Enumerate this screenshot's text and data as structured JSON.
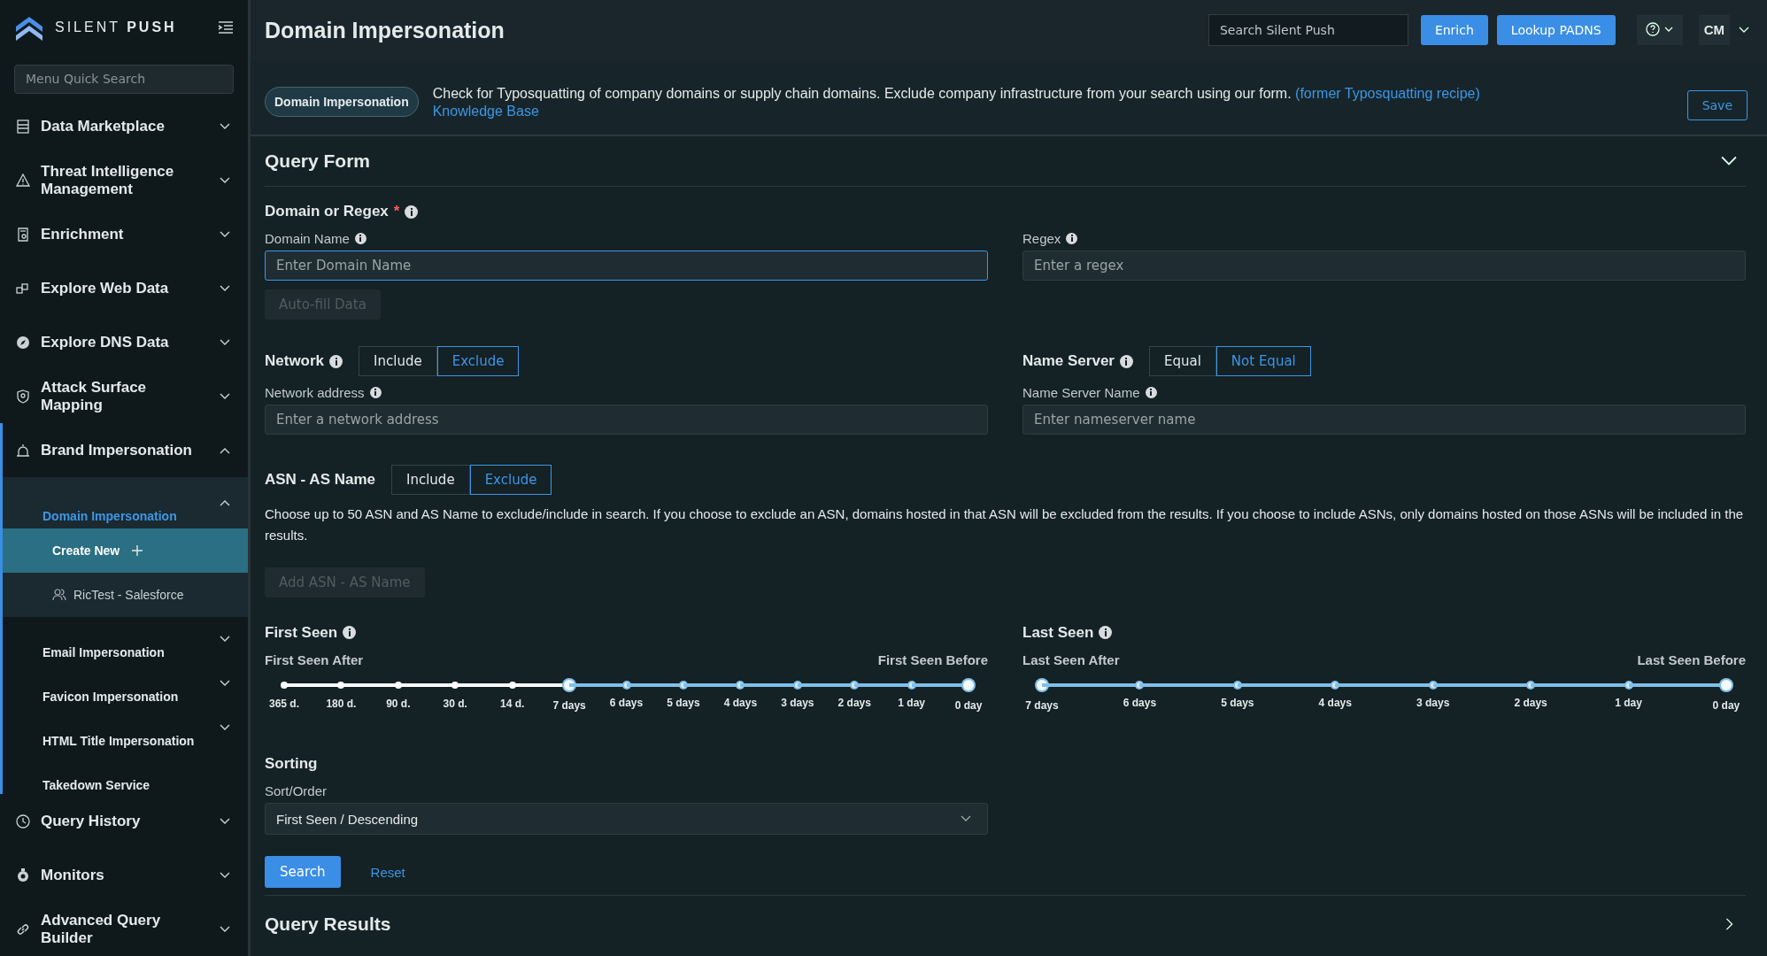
{
  "sidebar": {
    "brand": {
      "word_1": "SILENT",
      "word_2": "PUSH"
    },
    "search": {
      "placeholder": "Menu Quick Search"
    },
    "items": [
      {
        "label": "Data Marketplace",
        "expanded": false,
        "selected": false
      },
      {
        "label": "Threat Intelligence Management",
        "expanded": false,
        "selected": false
      },
      {
        "label": "Enrichment",
        "expanded": false,
        "selected": false
      },
      {
        "label": "Explore Web Data",
        "expanded": false,
        "selected": false
      },
      {
        "label": "Explore DNS Data",
        "expanded": false,
        "selected": false
      },
      {
        "label": "Attack Surface Mapping",
        "expanded": false,
        "selected": false
      },
      {
        "label": "Brand Impersonation",
        "expanded": true,
        "selected": true,
        "children": [
          {
            "label": "Domain Impersonation",
            "expanded": true,
            "selected": true,
            "children": [
              {
                "kind": "create",
                "label": "Create New",
                "selected": true
              },
              {
                "kind": "saved",
                "label": "RicTest - Salesforce",
                "selected": false
              }
            ]
          },
          {
            "label": "Email Impersonation",
            "expanded": false,
            "selected": false
          },
          {
            "label": "Favicon Impersonation",
            "expanded": false,
            "selected": false
          },
          {
            "label": "HTML Title Impersonation",
            "expanded": false,
            "selected": false
          },
          {
            "label": "Takedown Service",
            "selected": false
          }
        ]
      },
      {
        "label": "Query History",
        "expanded": false,
        "selected": false
      },
      {
        "label": "Monitors",
        "expanded": false,
        "selected": false
      },
      {
        "label": "Advanced Query Builder",
        "expanded": false,
        "selected": false
      }
    ]
  },
  "header": {
    "title": "Domain Impersonation",
    "search": {
      "placeholder": "Search Silent Push"
    },
    "buttons": [
      "Enrich",
      "Lookup PADNS"
    ],
    "user": "CM"
  },
  "info_bar": {
    "tag": "Domain Impersonation",
    "description": "Check for Typosquatting of company domains or supply chain domains. Exclude company infrastructure from your search using our form.",
    "link_1": "(former Typosquatting recipe)",
    "link_2": "Knowledge Base",
    "save": "Save"
  },
  "query_form": {
    "title": "Query Form",
    "expanded": true,
    "domain_group": {
      "label": "Domain or Regex",
      "required_mark": "*"
    },
    "domain_name": {
      "label": "Domain Name",
      "placeholder": "Enter Domain Name",
      "focused": true
    },
    "regex": {
      "label": "Regex",
      "placeholder": "Enter a regex"
    },
    "autofill": {
      "label": "Auto-fill Data",
      "disabled": true
    },
    "network": {
      "label": "Network",
      "options": [
        {
          "label": "Include",
          "selected": false
        },
        {
          "label": "Exclude",
          "selected": true
        }
      ],
      "field_label": "Network address",
      "placeholder": "Enter a network address"
    },
    "name_server": {
      "label": "Name Server",
      "options": [
        {
          "label": "Equal",
          "selected": false
        },
        {
          "label": "Not Equal",
          "selected": true
        }
      ],
      "field_label": "Name Server Name",
      "placeholder": "Enter nameserver name"
    },
    "asn": {
      "label": "ASN - AS Name",
      "options": [
        {
          "label": "Include",
          "selected": false
        },
        {
          "label": "Exclude",
          "selected": true
        }
      ],
      "description": "Choose up to 50 ASN and AS Name to exclude/include in search. If you choose to exclude an ASN, domains hosted in that ASN will be excluded from the results. If you choose to include ASNs, only domains hosted on those ASNs will be included in the results.",
      "add": {
        "label": "Add ASN - AS Name",
        "disabled": true
      }
    },
    "first_seen": {
      "label": "First Seen",
      "after": "First Seen After",
      "before": "First Seen Before",
      "ticks": [
        {
          "label": "365 d.",
          "in_range": false,
          "selected": false
        },
        {
          "label": "180 d.",
          "in_range": false,
          "selected": false
        },
        {
          "label": "90 d.",
          "in_range": false,
          "selected": false
        },
        {
          "label": "30 d.",
          "in_range": false,
          "selected": false
        },
        {
          "label": "14 d.",
          "in_range": false,
          "selected": false
        },
        {
          "label": "7 days",
          "in_range": true,
          "selected": true
        },
        {
          "label": "6 days",
          "in_range": true,
          "selected": false
        },
        {
          "label": "5 days",
          "in_range": true,
          "selected": false
        },
        {
          "label": "4 days",
          "in_range": true,
          "selected": false
        },
        {
          "label": "3 days",
          "in_range": true,
          "selected": false
        },
        {
          "label": "2 days",
          "in_range": true,
          "selected": false
        },
        {
          "label": "1 day",
          "in_range": true,
          "selected": false
        },
        {
          "label": "0 day",
          "in_range": true,
          "selected": true
        }
      ]
    },
    "last_seen": {
      "label": "Last Seen",
      "after": "Last Seen After",
      "before": "Last Seen Before",
      "ticks": [
        {
          "label": "7 days",
          "in_range": true,
          "selected": true
        },
        {
          "label": "6 days",
          "in_range": true,
          "selected": false
        },
        {
          "label": "5 days",
          "in_range": true,
          "selected": false
        },
        {
          "label": "4 days",
          "in_range": true,
          "selected": false
        },
        {
          "label": "3 days",
          "in_range": true,
          "selected": false
        },
        {
          "label": "2 days",
          "in_range": true,
          "selected": false
        },
        {
          "label": "1 day",
          "in_range": true,
          "selected": false
        },
        {
          "label": "0 day",
          "in_range": true,
          "selected": true
        }
      ]
    },
    "sorting": {
      "title": "Sorting",
      "label": "Sort/Order",
      "value": "First Seen / Descending"
    },
    "search": "Search",
    "reset": "Reset"
  },
  "query_results": {
    "title": "Query Results",
    "expanded": false
  }
}
